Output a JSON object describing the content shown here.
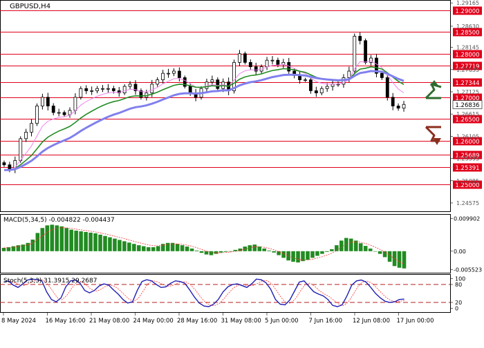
{
  "chart_data": [
    {
      "type": "line",
      "panel": "price",
      "title": "GBPUSD,H4",
      "ylim": [
        1.244,
        1.292
      ],
      "axis_ticks": [
        "1.29165",
        "1.28630",
        "1.28145",
        "1.27635",
        "1.27125",
        "1.26615",
        "1.26105",
        "1.25595",
        "1.25085",
        "1.24575"
      ],
      "axis_tick_values": [
        1.29165,
        1.2863,
        1.28145,
        1.27635,
        1.27125,
        1.26615,
        1.26105,
        1.25595,
        1.25085,
        1.24575
      ],
      "levels": [
        {
          "value": 1.29,
          "label": "1.29000"
        },
        {
          "value": 1.285,
          "label": "1.28500"
        },
        {
          "value": 1.28,
          "label": "1.28000"
        },
        {
          "value": 1.27719,
          "label": "1.27719"
        },
        {
          "value": 1.27344,
          "label": "1.27344"
        },
        {
          "value": 1.27,
          "label": "1.27000"
        },
        {
          "value": 1.265,
          "label": "1.26500"
        },
        {
          "value": 1.26,
          "label": "1.26000"
        },
        {
          "value": 1.25689,
          "label": "1.25689"
        },
        {
          "value": 1.25391,
          "label": "1.25391"
        },
        {
          "value": 1.25,
          "label": "1.25000"
        }
      ],
      "current_price": {
        "value": 1.26836,
        "label": "1.26836"
      },
      "closes": [
        1.2545,
        1.2535,
        1.2555,
        1.2605,
        1.262,
        1.264,
        1.268,
        1.27,
        1.268,
        1.2665,
        1.2665,
        1.266,
        1.267,
        1.27,
        1.272,
        1.2715,
        1.2715,
        1.272,
        1.272,
        1.272,
        1.2715,
        1.271,
        1.2725,
        1.273,
        1.2715,
        1.27,
        1.271,
        1.273,
        1.274,
        1.2755,
        1.2755,
        1.276,
        1.2745,
        1.2725,
        1.271,
        1.27,
        1.272,
        1.2735,
        1.274,
        1.272,
        1.2735,
        1.2715,
        1.278,
        1.28,
        1.278,
        1.277,
        1.276,
        1.277,
        1.2785,
        1.2785,
        1.2775,
        1.278,
        1.276,
        1.275,
        1.274,
        1.274,
        1.2715,
        1.271,
        1.272,
        1.2725,
        1.273,
        1.273,
        1.2745,
        1.276,
        1.284,
        1.283,
        1.278,
        1.279,
        1.2755,
        1.2745,
        1.27,
        1.268,
        1.2675,
        1.26836
      ],
      "series": [
        {
          "color": "#ee82ee"
        },
        {
          "color": "#228b22"
        },
        {
          "color": "#8080ee"
        }
      ],
      "signals": [
        {
          "icon": "up-arrow-icon",
          "color": "#2e6b2e"
        },
        {
          "icon": "down-arrow-icon",
          "color": "#8b2e1e"
        }
      ]
    },
    {
      "type": "bar",
      "panel": "macd",
      "title": "MACD(5,34,5) -0.004822 -0.004437",
      "ylim": [
        -0.0063,
        0.0108
      ],
      "axis_ticks": [
        "0.009902",
        "0.00",
        "-0.005523"
      ],
      "axis_tick_values": [
        0.009902,
        0,
        -0.005523
      ],
      "bar_color": "#228b22",
      "signal_color": "#ff3030",
      "values": [
        0.001,
        0.0012,
        0.0015,
        0.0018,
        0.002,
        0.0025,
        0.0035,
        0.0055,
        0.007,
        0.0078,
        0.008,
        0.0078,
        0.0075,
        0.007,
        0.0065,
        0.0062,
        0.006,
        0.0058,
        0.0056,
        0.0054,
        0.005,
        0.0046,
        0.0042,
        0.0038,
        0.0034,
        0.003,
        0.0026,
        0.0022,
        0.0018,
        0.0015,
        0.0012,
        0.0012,
        0.0015,
        0.0022,
        0.0025,
        0.0025,
        0.0022,
        0.0018,
        0.0014,
        0.0008,
        0.0002,
        -0.0005,
        -0.001,
        -0.0012,
        -0.0008,
        -0.0004,
        -0.0002,
        0.0,
        0.0004,
        0.0008,
        0.0014,
        0.0018,
        0.002,
        0.0014,
        0.0008,
        0.0002,
        -0.0004,
        -0.0012,
        -0.002,
        -0.0028,
        -0.0032,
        -0.0034,
        -0.003,
        -0.0026,
        -0.002,
        -0.0014,
        -0.0008,
        -0.0002,
        0.0006,
        0.0018,
        0.0032,
        0.004,
        0.0038,
        0.0032,
        0.0024,
        0.0016,
        0.0008,
        0.0,
        -0.0008,
        -0.0018,
        -0.0032,
        -0.0045,
        -0.005,
        -0.0052
      ]
    },
    {
      "type": "line",
      "panel": "stochastic",
      "title": "Stoch(5,3,3) 31.3915 29.2687",
      "ylim": [
        -10,
        110
      ],
      "axis_ticks": [
        "100",
        "80",
        "20",
        "0"
      ],
      "axis_tick_values": [
        100,
        80,
        20,
        0
      ],
      "levels": [
        80,
        20
      ],
      "main_color": "#1e1eb4",
      "signal_color": "#ff3030",
      "main": [
        88,
        92,
        78,
        70,
        82,
        95,
        98,
        96,
        92,
        55,
        30,
        22,
        35,
        72,
        92,
        95,
        84,
        60,
        52,
        60,
        75,
        82,
        78,
        62,
        48,
        30,
        18,
        22,
        60,
        90,
        96,
        92,
        80,
        70,
        72,
        84,
        92,
        90,
        84,
        62,
        38,
        18,
        8,
        6,
        14,
        30,
        55,
        72,
        80,
        82,
        76,
        70,
        82,
        98,
        96,
        86,
        64,
        30,
        14,
        12,
        28,
        58,
        88,
        92,
        74,
        56,
        48,
        42,
        30,
        10,
        6,
        12,
        42,
        78,
        92,
        95,
        88,
        70,
        50,
        35,
        24,
        20,
        22,
        30,
        31
      ]
    }
  ],
  "x_axis": {
    "labels": [
      "8 May 2024",
      "16 May 16:00",
      "21 May 08:00",
      "24 May 00:00",
      "28 May 16:00",
      "31 May 08:00",
      "5 Jun 00:00",
      "7 Jun 16:00",
      "12 Jun 08:00",
      "17 Jun 00:00"
    ]
  }
}
